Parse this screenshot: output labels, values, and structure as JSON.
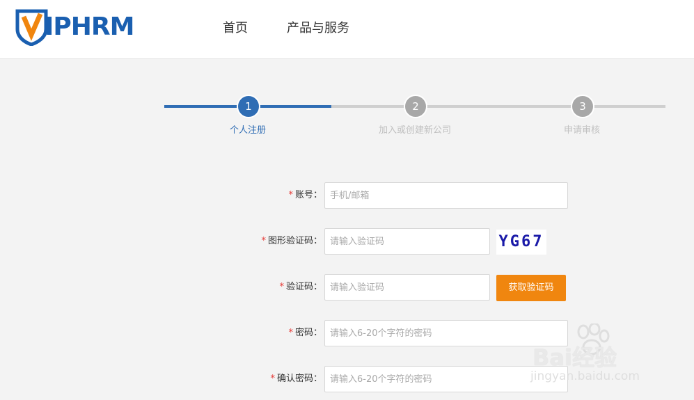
{
  "header": {
    "logo": {
      "v": "V",
      "rest": "IPHRM"
    },
    "nav": [
      {
        "label": "首页"
      },
      {
        "label": "产品与服务"
      }
    ]
  },
  "steps": [
    {
      "number": "1",
      "label": "个人注册",
      "status": "active"
    },
    {
      "number": "2",
      "label": "加入或创建新公司",
      "status": "inactive"
    },
    {
      "number": "3",
      "label": "申请审核",
      "status": "inactive"
    }
  ],
  "form": {
    "required_mark": "*",
    "account": {
      "label": "账号：",
      "placeholder": "手机/邮箱"
    },
    "captcha_image": {
      "label": "图形验证码：",
      "placeholder": "请输入验证码",
      "captcha_text": "YG67"
    },
    "sms_code": {
      "label": "验证码：",
      "placeholder": "请输入验证码",
      "button": "获取验证码"
    },
    "password": {
      "label": "密码：",
      "placeholder": "请输入6-20个字符的密码"
    },
    "confirm_password": {
      "label": "确认密码：",
      "placeholder": "请输入6-20个字符的密码"
    }
  },
  "watermark": {
    "text": "Bai经验",
    "sub": "jingyan.baidu.com"
  },
  "colors": {
    "brand_blue": "#2f6db4",
    "logo_orange": "#f0860f",
    "button_orange": "#f0860f",
    "inactive_gray": "#a8a8a8",
    "required_red": "#e53935"
  }
}
